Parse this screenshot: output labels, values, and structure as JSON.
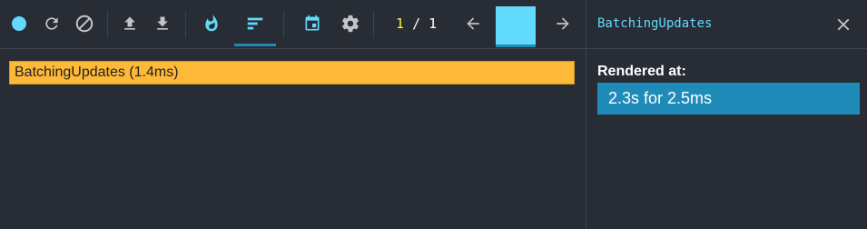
{
  "toolbar": {
    "icons": [
      "record-dot-icon",
      "reload-icon",
      "clear-icon",
      "upload-icon",
      "download-icon",
      "flame-icon",
      "ranked-icon",
      "calendar-icon",
      "gear-icon",
      "arrow-left-icon",
      "arrow-right-icon"
    ],
    "commit_current": "1",
    "commit_separator": "/",
    "commit_total": "1",
    "colors": {
      "accent": "#61dafb",
      "selected_underline": "#1e8bb8",
      "counter_current": "#ffe94d"
    }
  },
  "chart": {
    "bars": [
      {
        "label": "BatchingUpdates (1.4ms)",
        "color": "#ffb938"
      }
    ]
  },
  "sidebar": {
    "title": "BatchingUpdates",
    "rendered_at_label": "Rendered at:",
    "rendered_entries": [
      "2.3s for 2.5ms"
    ],
    "colors": {
      "entry_bg": "#1e8bb8"
    }
  }
}
